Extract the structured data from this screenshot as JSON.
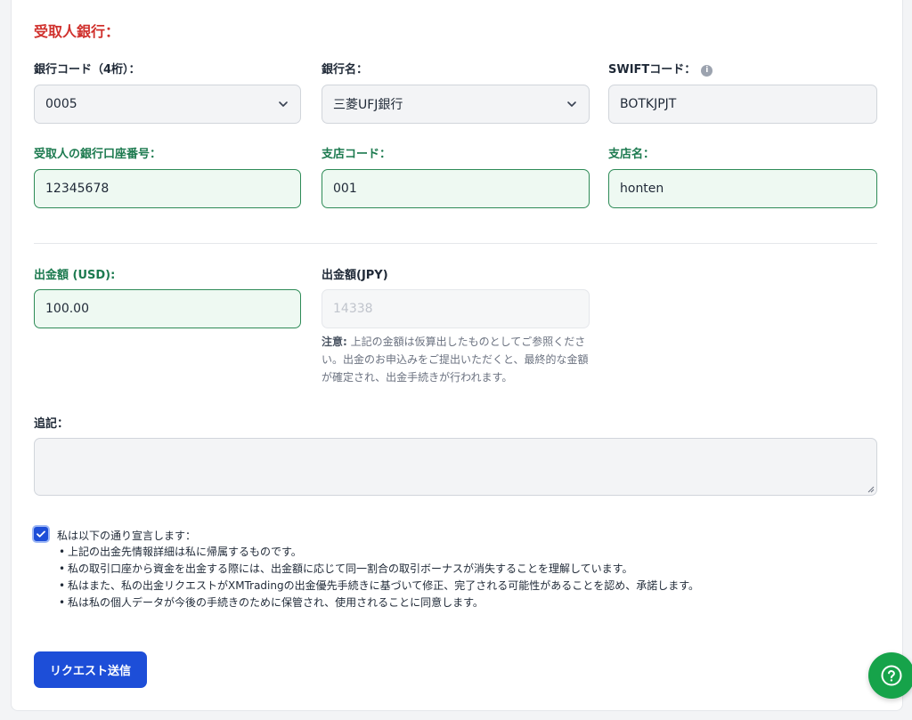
{
  "section_title": "受取人銀行：",
  "bank_code": {
    "label": "銀行コード（4桁）：",
    "value": "0005"
  },
  "bank_name": {
    "label": "銀行名：",
    "value": "三菱UFJ銀行"
  },
  "swift": {
    "label": "SWIFTコード：",
    "value": "BOTKJPJT",
    "info_icon": "info-icon"
  },
  "account_number": {
    "label": "受取人の銀行口座番号：",
    "value": "12345678"
  },
  "branch_code": {
    "label": "支店コード：",
    "value": "001"
  },
  "branch_name": {
    "label": "支店名：",
    "value": "honten"
  },
  "amount_usd": {
    "label": "出金額 (USD):",
    "value": "100.00"
  },
  "amount_jpy": {
    "label": "出金額(JPY)",
    "value": "14338"
  },
  "note": {
    "prefix": "注意:",
    "text": " 上記の金額は仮算出したものとしてご参照ください。出金のお申込みをご提出いただくと、最終的な金額が確定され、出金手続きが行われます。"
  },
  "remarks": {
    "label": "追記：",
    "value": ""
  },
  "declaration": {
    "checked": true,
    "heading": "私は以下の通り宣言します：",
    "items": [
      "上記の出金先情報詳細は私に帰属するものです。",
      "私の取引口座から資金を出金する際には、出金額に応じて同一割合の取引ボーナスが消失することを理解しています。",
      "私はまた、私の出金リクエストがXMTradingの出金優先手続きに基づいて修正、完了される可能性があることを認め、承諾します。",
      "私は私の個人データが今後の手続きのために保管され、使用されることに同意します。"
    ]
  },
  "submit_label": "リクエスト送信",
  "colors": {
    "accent": "#1d4ed8",
    "valid_green": "#1c7a4f",
    "section_red": "#d0312d",
    "help_green": "#16a34a"
  }
}
